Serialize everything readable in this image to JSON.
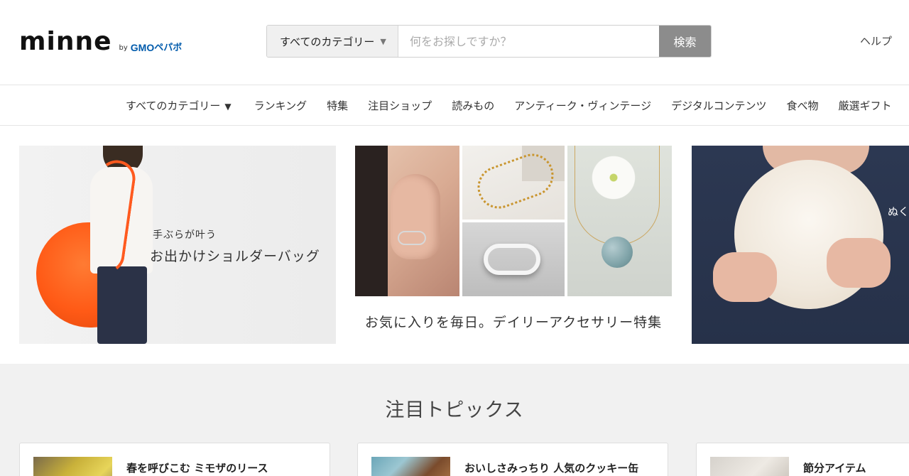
{
  "header": {
    "logo": {
      "wordmark": "minne",
      "by": "by",
      "company": "GMO",
      "company_suffix": "ペパボ"
    },
    "search": {
      "category_label": "すべてのカテゴリー",
      "placeholder": "何をお探しですか？",
      "button_label": "検索"
    },
    "help_label": "ヘルプ"
  },
  "nav": {
    "items": [
      {
        "label": "すべてのカテゴリー",
        "has_caret": true
      },
      {
        "label": "ランキング"
      },
      {
        "label": "特集"
      },
      {
        "label": "注目ショップ"
      },
      {
        "label": "読みもの"
      },
      {
        "label": "アンティーク・ヴィンテージ"
      },
      {
        "label": "デジタルコンテンツ"
      },
      {
        "label": "食べ物"
      },
      {
        "label": "厳選ギフト"
      }
    ]
  },
  "banners": [
    {
      "caption_small": "手ぶらが叶う",
      "caption_big": "お出かけショルダーバッグ"
    },
    {
      "caption": "お気に入りを毎日。デイリーアクセサリー特集"
    },
    {
      "caption": "ぬく"
    }
  ],
  "topics": {
    "title": "注目トピックス",
    "cards": [
      {
        "label": "春を呼びこむ ミモザのリース"
      },
      {
        "label": "おいしさみっちり 人気のクッキー缶"
      },
      {
        "label": "節分アイテム"
      }
    ]
  },
  "colors": {
    "search_button_bg": "#8c8c8c",
    "brand_blue": "#005bac",
    "topics_bg": "#f1f1f1"
  }
}
